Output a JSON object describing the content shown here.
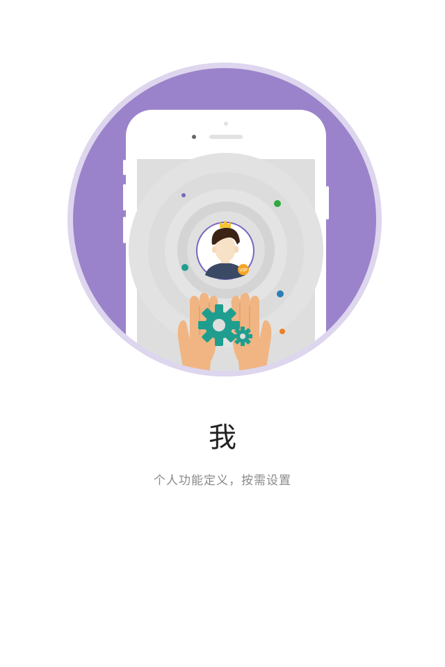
{
  "page": {
    "title": "我",
    "subtitle": "个人功能定义，按需设置"
  },
  "badge": {
    "vip_label": "VIP"
  },
  "colors": {
    "background": "#ffffff",
    "outer_ring": "#ddd6ee",
    "circle_fill": "#9b83cb",
    "phone_body": "#ffffff",
    "phone_screen": "#dedede",
    "gear": "#1f9e8f",
    "hand": "#f0b582",
    "crown": "#f5c431",
    "badge": "#f5a623",
    "title_text": "#222222",
    "subtitle_text": "#8a8a8a"
  },
  "icons": [
    "phone-icon",
    "avatar-icon",
    "crown-icon",
    "vip-badge-icon",
    "hands-icon",
    "gear-icon"
  ]
}
